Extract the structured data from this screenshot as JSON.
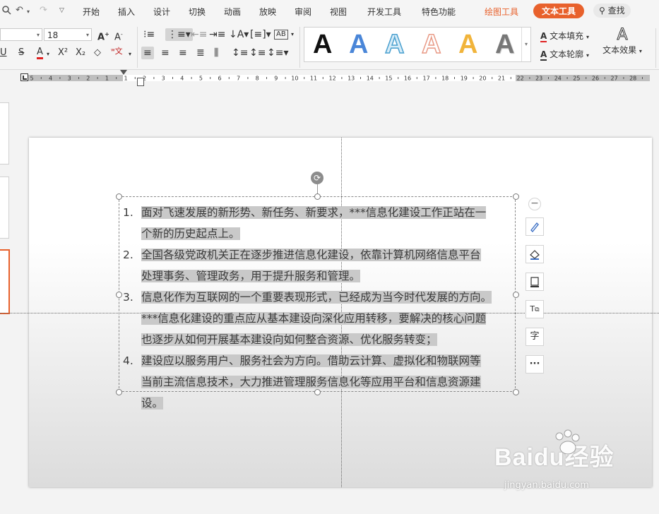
{
  "menu": {
    "tabs": [
      "开始",
      "插入",
      "设计",
      "切换",
      "动画",
      "放映",
      "审阅",
      "视图",
      "开发工具",
      "特色功能"
    ],
    "context_tab": "绘图工具",
    "active_tab": "文本工具",
    "search": "查找"
  },
  "ribbon": {
    "font_size": "18",
    "wordart_fill": "文本填充",
    "wordart_outline": "文本轮廓",
    "text_effect": "文本效果",
    "gallery_letter": "A"
  },
  "ruler": {
    "labels": [
      "5",
      "4",
      "3",
      "2",
      "1",
      "1",
      "2",
      "3",
      "4",
      "5",
      "6",
      "7",
      "8",
      "9",
      "10",
      "11",
      "12",
      "13",
      "14",
      "15",
      "16",
      "17",
      "18",
      "19",
      "20",
      "21",
      "22",
      "23",
      "24",
      "25",
      "26",
      "27",
      "28"
    ]
  },
  "textbox": {
    "items": [
      {
        "num": "1.",
        "lines": [
          "面对飞速发展的新形势、新任务、新要求，***信息化建设工作正站在一",
          "个新的历史起点上。"
        ]
      },
      {
        "num": "2.",
        "lines": [
          "全国各级党政机关正在逐步推进信息化建设，依靠计算机网络信息平台",
          "处理事务、管理政务，用于提升服务和管理。"
        ]
      },
      {
        "num": "3.",
        "lines": [
          "信息化作为互联网的一个重要表现形式，已经成为当今时代发展的方向。",
          "***信息化建设的重点应从基本建设向深化应用转移，要解决的核心问题",
          "也逐步从如何开展基本建设向如何整合资源、优化服务转变；"
        ]
      },
      {
        "num": "4.",
        "lines": [
          "建设应以服务用户、服务社会为方向。借助云计算、虚拟化和物联网等",
          "当前主流信息技术，大力推进管理服务信息化等应用平台和信息资源建",
          "设。"
        ]
      }
    ]
  },
  "float_tools": {
    "more": "···"
  },
  "watermark": {
    "brand": "Baidu经验",
    "url": "jingyan.baidu.com"
  }
}
